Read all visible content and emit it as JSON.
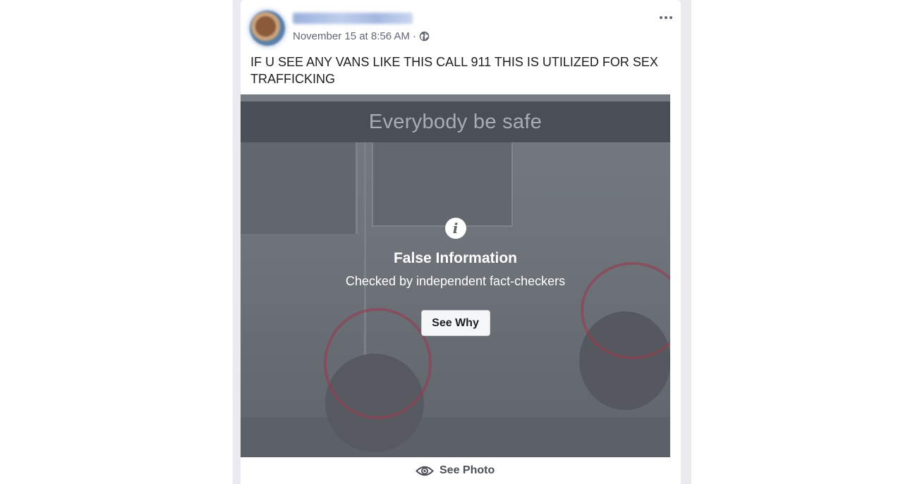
{
  "post": {
    "author_name": "",
    "timestamp": "November 15 at 8:56 AM",
    "separator": "·",
    "privacy_icon": "globe-icon",
    "more_icon": "more-options-icon",
    "text": "IF U SEE ANY VANS LIKE THIS CALL 911 THIS IS UTILIZED FOR SEX TRAFFICKING",
    "photo_caption": "Everybody be safe"
  },
  "fact_check": {
    "icon": "info-icon",
    "title": "False Information",
    "subtitle": "Checked by independent fact-checkers",
    "button_label": "See Why"
  },
  "footer": {
    "icon": "eye-icon",
    "see_photo_label": "See Photo"
  },
  "colors": {
    "overlay": "#5e646c",
    "caption_band": "#4a4f57",
    "meta_text": "#606770",
    "post_text": "#1c1e21"
  }
}
